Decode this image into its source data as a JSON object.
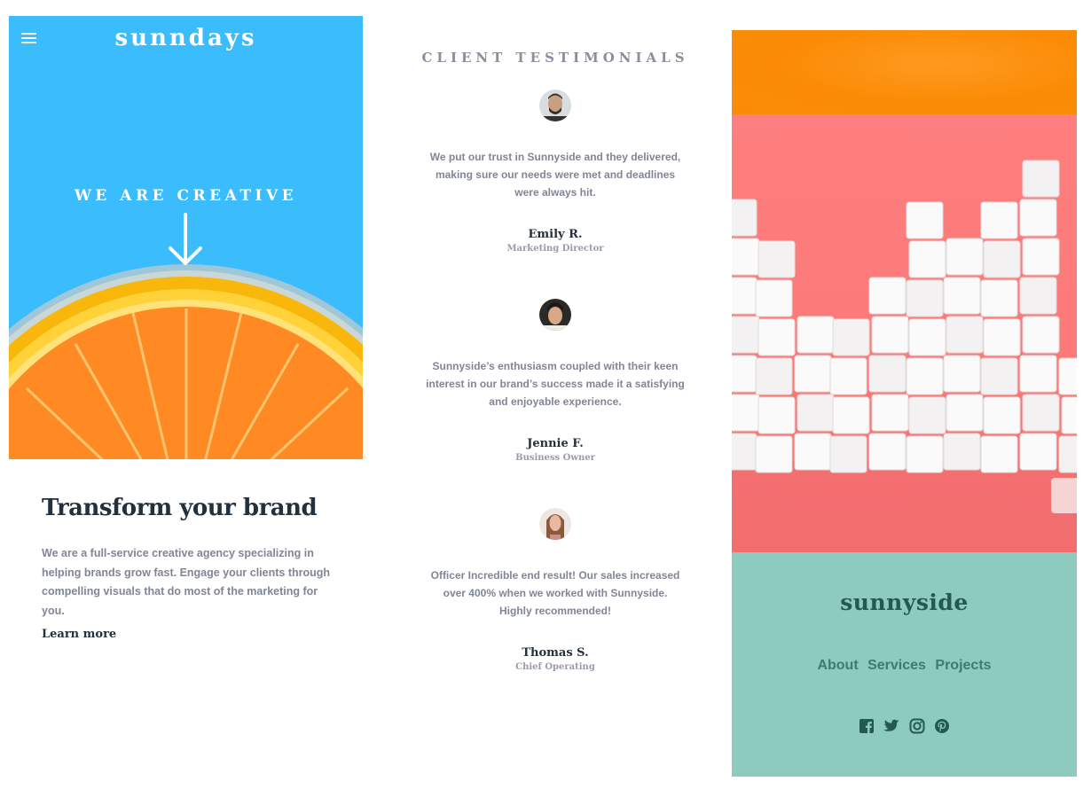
{
  "hero": {
    "brand": "sunndays",
    "tagline": "WE ARE CREATIVE",
    "bg_color": "#3bbcfd"
  },
  "intro": {
    "title": "Transform your brand",
    "body": "We are a full-service creative agency specializing in helping brands grow fast. Engage your clients through compelling visuals that do most of the marketing for you.",
    "link": "Learn more"
  },
  "testimonials": {
    "title": "CLIENT TESTIMONIALS",
    "items": [
      {
        "quote": "We put our trust in Sunnyside and they delivered, making sure our needs were met and deadlines were always hit.",
        "name": "Emily R.",
        "role": "Marketing Director"
      },
      {
        "quote": "Sunnyside’s enthusiasm coupled with their keen interest in our brand’s success made it a satisfying and enjoyable experience.",
        "name": "Jennie F.",
        "role": "Business Owner"
      },
      {
        "quote": "Officer Incredible end result! Our sales increased over 400% when we worked with Sunnyside. Highly recommended!",
        "name": "Thomas S.",
        "role": "Chief Operating"
      }
    ]
  },
  "footer": {
    "logo": "sunnyside",
    "nav": [
      "About",
      "Services",
      "Projects"
    ],
    "social_icons": [
      "facebook-icon",
      "twitter-icon",
      "instagram-icon",
      "pinterest-icon"
    ],
    "bg_color": "#8ccbbd"
  }
}
